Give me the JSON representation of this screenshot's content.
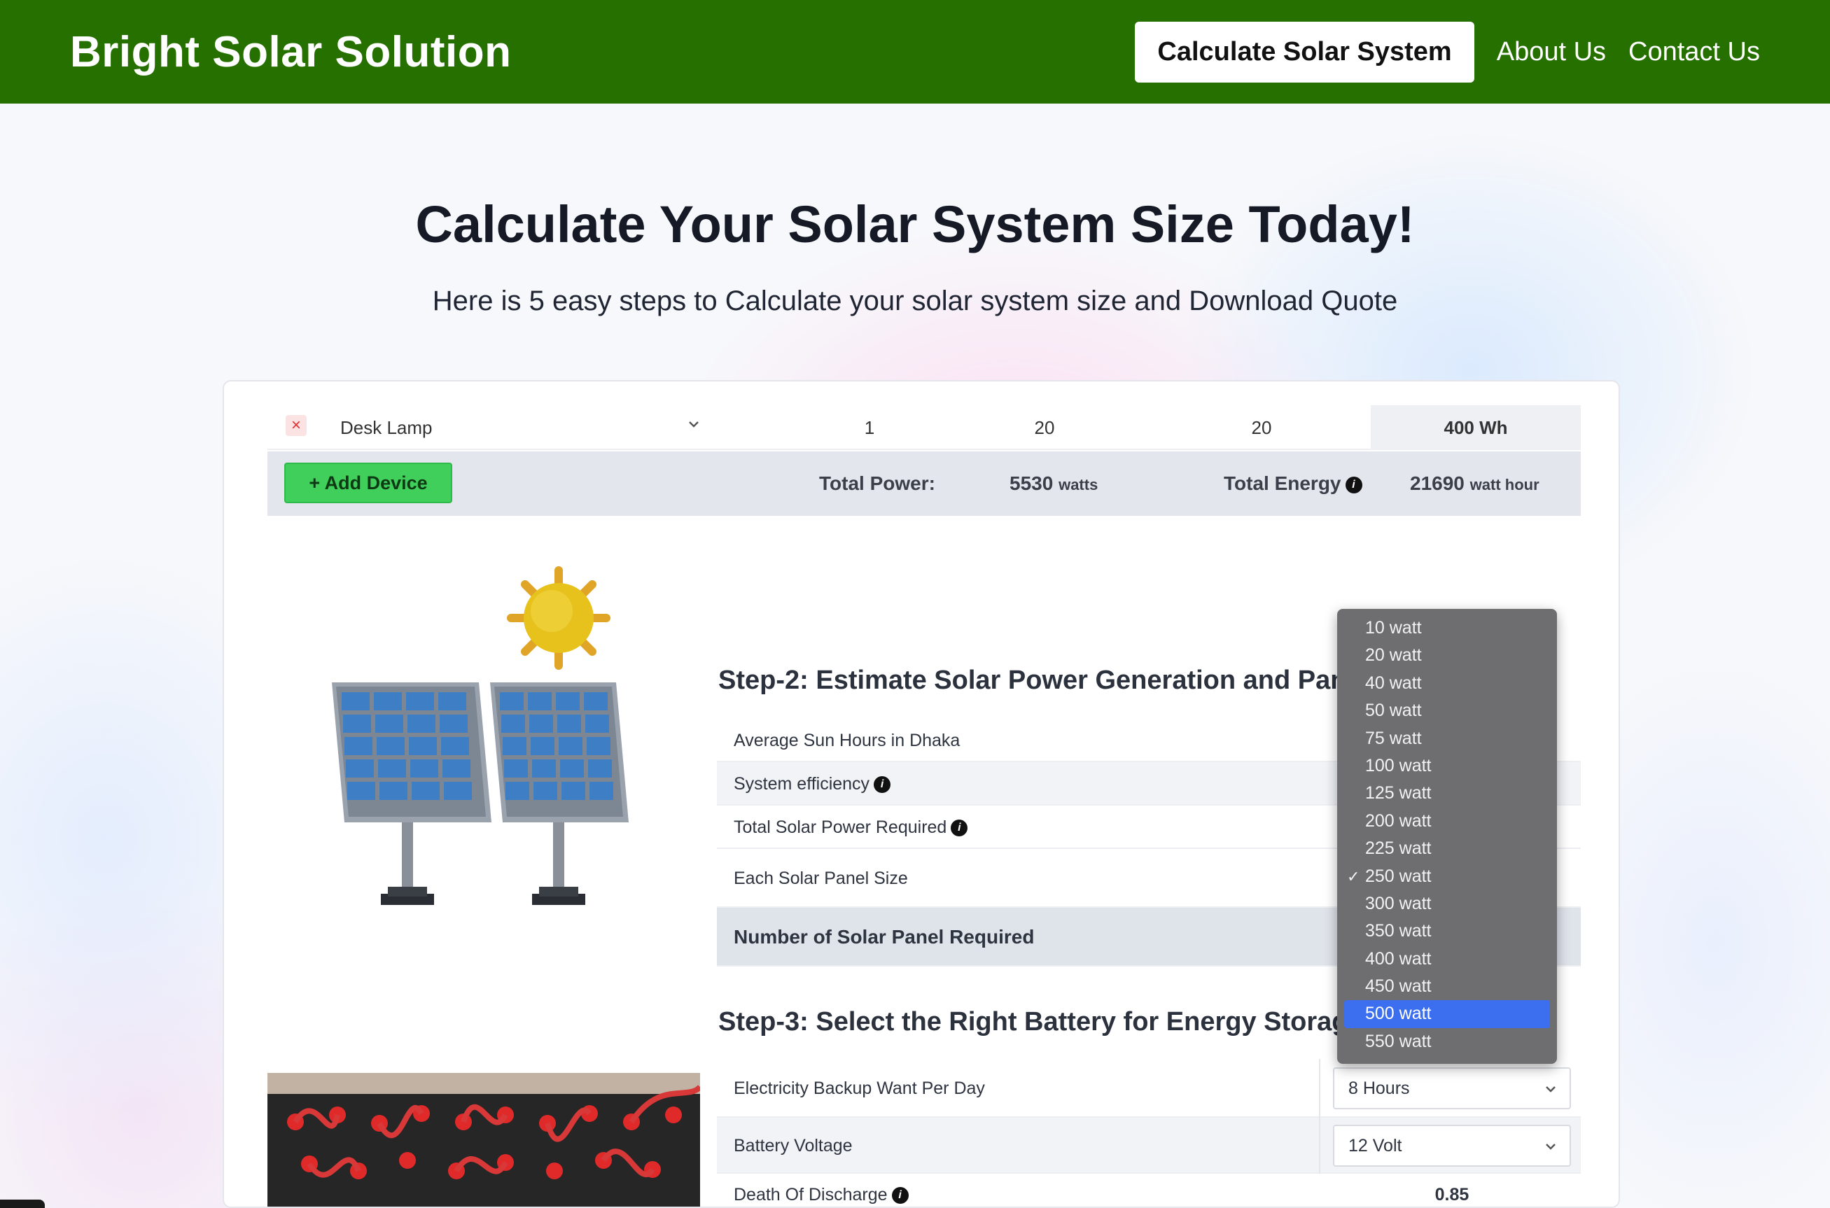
{
  "header": {
    "brand": "Bright Solar Solution",
    "nav_button": "Calculate Solar System",
    "nav_about": "About Us",
    "nav_contact": "Contact Us"
  },
  "hero": {
    "title": "Calculate Your Solar System Size Today!",
    "subtitle": "Here is 5 easy steps to Calculate your solar system size and Download Quote"
  },
  "device_row": {
    "remove_icon": "×",
    "device": "Desk Lamp",
    "quantity": "1",
    "watts": "20",
    "hours": "20",
    "energy": "400  Wh"
  },
  "totals": {
    "add_button": "+ Add Device",
    "power_label": "Total Power:",
    "power_value": "5530",
    "power_unit": "watts",
    "energy_label": "Total Energy",
    "energy_value": "21690",
    "energy_unit": "watt hour"
  },
  "step2": {
    "title": "Step-2: Estimate Solar Power Generation and Panel S",
    "rows": [
      "Average Sun Hours in Dhaka",
      "System efficiency",
      "Total Solar Power Required",
      "Each Solar Panel Size",
      "Number of Solar Panel Required"
    ]
  },
  "panel_dropdown": {
    "options": [
      "10 watt",
      "20 watt",
      "40 watt",
      "50 watt",
      "75 watt",
      "100 watt",
      "125 watt",
      "200 watt",
      "225 watt",
      "250 watt",
      "300 watt",
      "350 watt",
      "400 watt",
      "450 watt",
      "500 watt",
      "550 watt"
    ],
    "selected": "250 watt",
    "highlighted": "500 watt"
  },
  "step3": {
    "title": "Step-3: Select the Right Battery for Energy Storage",
    "rows": [
      {
        "label": "Electricity Backup Want Per Day",
        "value": "8 Hours"
      },
      {
        "label": "Battery Voltage",
        "value": "12 Volt"
      },
      {
        "label": "Death Of Discharge",
        "value": "0.85"
      }
    ]
  },
  "colors": {
    "header_bg": "#267000",
    "add_button_bg": "#3fcf5a",
    "dropdown_bg": "#6e6e70",
    "dropdown_highlight": "#3c6ff0"
  }
}
